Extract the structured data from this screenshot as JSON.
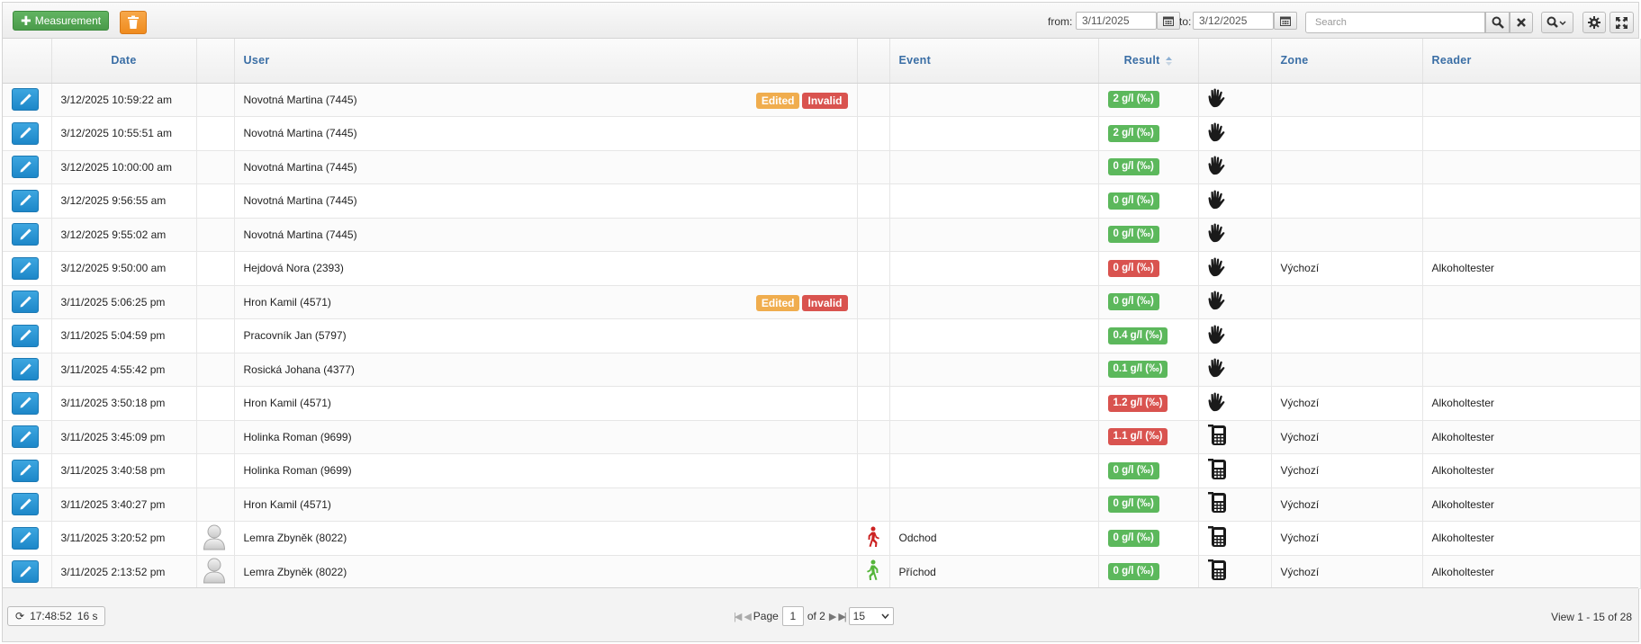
{
  "toolbar": {
    "add_label": "Measurement",
    "from_label": "from:",
    "from_value": "3/11/2025",
    "to_label": "to:",
    "to_value": "3/12/2025",
    "search_placeholder": "Search"
  },
  "columns": {
    "date": "Date",
    "user": "User",
    "event": "Event",
    "result": "Result",
    "zone": "Zone",
    "reader": "Reader"
  },
  "tags": {
    "edited": "Edited",
    "invalid": "Invalid"
  },
  "rows": [
    {
      "date": "3/12/2025 10:59:22 am",
      "user": "Novotná Martina (7445)",
      "tags": true,
      "result": "2 g/l (‰)",
      "status": "ok",
      "src": "hand",
      "zone": "",
      "reader": "",
      "event": "",
      "event_icon": "",
      "avatar": false
    },
    {
      "date": "3/12/2025 10:55:51 am",
      "user": "Novotná Martina (7445)",
      "tags": false,
      "result": "2 g/l (‰)",
      "status": "ok",
      "src": "hand",
      "zone": "",
      "reader": "",
      "event": "",
      "event_icon": "",
      "avatar": false
    },
    {
      "date": "3/12/2025 10:00:00 am",
      "user": "Novotná Martina (7445)",
      "tags": false,
      "result": "0 g/l (‰)",
      "status": "ok",
      "src": "hand",
      "zone": "",
      "reader": "",
      "event": "",
      "event_icon": "",
      "avatar": false
    },
    {
      "date": "3/12/2025 9:56:55 am",
      "user": "Novotná Martina (7445)",
      "tags": false,
      "result": "0 g/l (‰)",
      "status": "ok",
      "src": "hand",
      "zone": "",
      "reader": "",
      "event": "",
      "event_icon": "",
      "avatar": false
    },
    {
      "date": "3/12/2025 9:55:02 am",
      "user": "Novotná Martina (7445)",
      "tags": false,
      "result": "0 g/l (‰)",
      "status": "ok",
      "src": "hand",
      "zone": "",
      "reader": "",
      "event": "",
      "event_icon": "",
      "avatar": false
    },
    {
      "date": "3/12/2025 9:50:00 am",
      "user": "Hejdová Nora (2393)",
      "tags": false,
      "result": "0 g/l (‰)",
      "status": "bad",
      "src": "hand",
      "zone": "Výchozí",
      "reader": "Alkoholtester",
      "event": "",
      "event_icon": "",
      "avatar": false
    },
    {
      "date": "3/11/2025 5:06:25 pm",
      "user": "Hron Kamil (4571)",
      "tags": true,
      "result": "0 g/l (‰)",
      "status": "ok",
      "src": "hand",
      "zone": "",
      "reader": "",
      "event": "",
      "event_icon": "",
      "avatar": false
    },
    {
      "date": "3/11/2025 5:04:59 pm",
      "user": "Pracovník Jan (5797)",
      "tags": false,
      "result": "0.4 g/l (‰)",
      "status": "ok",
      "src": "hand",
      "zone": "",
      "reader": "",
      "event": "",
      "event_icon": "",
      "avatar": false
    },
    {
      "date": "3/11/2025 4:55:42 pm",
      "user": "Rosická Johana (4377)",
      "tags": false,
      "result": "0.1 g/l (‰)",
      "status": "ok",
      "src": "hand",
      "zone": "",
      "reader": "",
      "event": "",
      "event_icon": "",
      "avatar": false
    },
    {
      "date": "3/11/2025 3:50:18 pm",
      "user": "Hron Kamil (4571)",
      "tags": false,
      "result": "1.2 g/l (‰)",
      "status": "bad",
      "src": "hand",
      "zone": "Výchozí",
      "reader": "Alkoholtester",
      "event": "",
      "event_icon": "",
      "avatar": false
    },
    {
      "date": "3/11/2025 3:45:09 pm",
      "user": "Holinka Roman (9699)",
      "tags": false,
      "result": "1.1 g/l (‰)",
      "status": "bad",
      "src": "device",
      "zone": "Výchozí",
      "reader": "Alkoholtester",
      "event": "",
      "event_icon": "",
      "avatar": false
    },
    {
      "date": "3/11/2025 3:40:58 pm",
      "user": "Holinka Roman (9699)",
      "tags": false,
      "result": "0 g/l (‰)",
      "status": "ok",
      "src": "device",
      "zone": "Výchozí",
      "reader": "Alkoholtester",
      "event": "",
      "event_icon": "",
      "avatar": false
    },
    {
      "date": "3/11/2025 3:40:27 pm",
      "user": "Hron Kamil (4571)",
      "tags": false,
      "result": "0 g/l (‰)",
      "status": "ok",
      "src": "device",
      "zone": "Výchozí",
      "reader": "Alkoholtester",
      "event": "",
      "event_icon": "",
      "avatar": false
    },
    {
      "date": "3/11/2025 3:20:52 pm",
      "user": "Lemra Zbyněk (8022)",
      "tags": false,
      "result": "0 g/l (‰)",
      "status": "ok",
      "src": "device",
      "zone": "Výchozí",
      "reader": "Alkoholtester",
      "event": "Odchod",
      "event_icon": "exit",
      "avatar": true
    },
    {
      "date": "3/11/2025 2:13:52 pm",
      "user": "Lemra Zbyněk (8022)",
      "tags": false,
      "result": "0 g/l (‰)",
      "status": "ok",
      "src": "device",
      "zone": "Výchozí",
      "reader": "Alkoholtester",
      "event": "Příchod",
      "event_icon": "entry",
      "avatar": true
    }
  ],
  "footer": {
    "clock": "17:48:52",
    "interval": "16 s",
    "page_label": "Page",
    "page_value": "1",
    "of_label": "of 2",
    "per_page": "15",
    "view_info": "View 1 - 15 of 28"
  },
  "colors": {
    "ok": "#5cb85c",
    "bad": "#d9534f",
    "edited": "#f0ad4e",
    "accent": "#1d87c9",
    "header_text": "#3a6ea5"
  }
}
